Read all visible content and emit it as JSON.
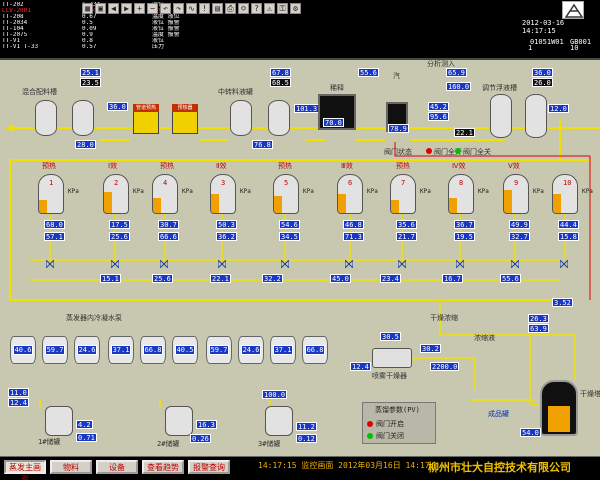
{
  "header": {
    "alarms": [
      {
        "tag": "TT-202",
        "value": "1.234",
        "desc": "液位"
      },
      {
        "tag": "LCV-2001",
        "value": "0.7c",
        "desc": "流量"
      },
      {
        "tag": "TT-208",
        "value": "0.67",
        "desc": "温度 液位"
      },
      {
        "tag": "TT-2034",
        "value": "0.5",
        "desc": "液位 报警"
      },
      {
        "tag": "TT-104",
        "value": "0.09",
        "desc": "液位 报警"
      },
      {
        "tag": "TT-2075",
        "value": "0.9",
        "desc": "温度 报警"
      },
      {
        "tag": "TT-V1",
        "value": "0.8",
        "desc": "液位"
      },
      {
        "tag": "TT-V1 T-33",
        "value": "0.57",
        "desc": "压力"
      }
    ],
    "toolbar_icons": [
      "grid-icon",
      "window-icon",
      "back-icon",
      "forward-icon",
      "zoom-in-icon",
      "zoom-out-icon",
      "undo-icon",
      "redo-icon",
      "trend-icon",
      "alarm-icon",
      "report-icon",
      "print-icon",
      "user-icon",
      "help-icon",
      "warning-icon",
      "lock-icon",
      "settings-icon"
    ],
    "datetime": "2012-03-16 14:17:15",
    "tag1": "01051W01",
    "tag2": "GB001",
    "num1": "1",
    "num2": "10"
  },
  "process": {
    "labels": {
      "mix_tank": "混合配料槽",
      "mid_tank": "中转料液罐",
      "preheat": "预热器",
      "pipeline_pre": "管道预热",
      "dilute": "稀释",
      "analysis": "分析测入",
      "float_tank": "调节浮液槽",
      "steam_in": "汽",
      "vacuum": "真空",
      "effect_1": "Ⅰ效",
      "effect_2": "Ⅱ效",
      "effect_3": "Ⅲ效",
      "effect_4": "Ⅳ效",
      "effect_5": "Ⅴ效",
      "pre1": "预热",
      "pre2": "预热",
      "pre3": "预热",
      "pre4": "预热",
      "cond_pump": "蒸发器内冷凝水泵",
      "dryer": "喷雾干燥器",
      "cooling": "冷凝器出水",
      "drying_conc": "干燥浓缩",
      "pump_area": "浓缩液",
      "storage_1": "1#储罐",
      "storage_2": "2#储罐",
      "storage_3": "3#储罐",
      "product": "干燥塔",
      "finish": "成品罐",
      "legend_title": "蒸馏参数(PV)",
      "legend_open": "阀门开启",
      "legend_close": "阀门关闭",
      "status_1": "阀门状态",
      "status_2": "阀门全开",
      "status_3": "阀门全关",
      "eff_num": [
        "1",
        "2",
        "4",
        "3",
        "5",
        "6",
        "7",
        "8",
        "9",
        "10"
      ],
      "eff_lbl": [
        "Ⅰ效",
        "Ⅱ效",
        "Ⅲ效",
        "Ⅳ效",
        "Ⅴ效"
      ]
    },
    "values": {
      "v_mix_a": "25.1",
      "v_mix_b": "23.5",
      "v_mix_c": "28.0",
      "v_mix_d": "36.0",
      "v_mix_e": "43.7",
      "v_mid_a": "67.8",
      "v_mid_b": "68.5",
      "v_mid_c": "101.3",
      "v_mid_d": "76.8",
      "v_pre_a": "70.0",
      "v_dil_a": "78.9",
      "v_dil_b": "55.6",
      "v_an_a": "65.9",
      "v_an_b": "160.0",
      "v_an_c": "45.2",
      "v_an_d": "95.6",
      "v_an_e": "22.1",
      "v_fl_a": "36.0",
      "v_fl_b": "26.0",
      "v_fl_c": "12.0",
      "v_e1": "68.0",
      "v_e2": "17.5",
      "v_e3": "30.7",
      "v_e4": "50.3",
      "v_e5": "54.6",
      "v_e6": "46.8",
      "v_e7": "35.6",
      "v_e8": "36.7",
      "v_e9": "49.9",
      "v_e10": "44.4",
      "v_e11": "57.1",
      "v_e12": "25.6",
      "v_e13": "66.6",
      "v_e14": "36.2",
      "v_e15": "34.5",
      "v_e16": "71.3",
      "v_e17": "21.7",
      "v_e18": "19.5",
      "v_e19": "32.7",
      "v_e20": "15.8",
      "v_e21": "50.0",
      "v_e22": "39.8",
      "v_e23": "46.8",
      "v_e24": "63.2",
      "v_p1": "15.1",
      "v_p2": "25.6",
      "v_p3": "22.1",
      "v_p4": "32.2",
      "v_p5": "45.0",
      "v_p6": "23.4",
      "v_p7": "16.7",
      "v_p8": "55.6",
      "v_s1": "40.6",
      "v_s2": "59.7",
      "v_s3": "24.6",
      "v_s4": "37.1",
      "v_s5": "66.8",
      "v_s6": "40.5",
      "v_s7": "59.7",
      "v_s8": "24.6",
      "v_s9": "37.1",
      "v_s10": "66.8",
      "v_dry_a": "30.2",
      "v_dry_b": "12.4",
      "v_dry_c": "30.5",
      "v_dry_d": "2200.0",
      "v_st1_a": "11.0",
      "v_st1_b": "12.4",
      "v_st1_c": "4.2",
      "v_st1_d": "0.71",
      "v_st2_a": "16.3",
      "v_st2_b": "0.26",
      "v_st3_a": "11.2",
      "v_st3_b": "0.12",
      "v_st3_c": "100.0",
      "v_fin_a": "26.3",
      "v_fin_b": "63.9",
      "v_fin_c": "3.52",
      "v_fin_d": "54.0"
    },
    "units": {
      "kpa": "KPa",
      "deg": "℃",
      "pct": "%",
      "mpa": "MPa"
    }
  },
  "nav": {
    "buttons": [
      "蒸发主画面",
      "物料",
      "设备",
      "查看趋势",
      "报警查询"
    ],
    "ticker": "14:17:15  监控画面  2012年03月16日 14:17",
    "company": "柳州市壮大自控技术有限公司"
  },
  "colors": {
    "bg_process": "#c8c8b0",
    "pipe_yellow": "#f0e000",
    "pipe_red": "#e00000",
    "value_blue": "#1838c8",
    "level_orange": "#f0a000"
  }
}
